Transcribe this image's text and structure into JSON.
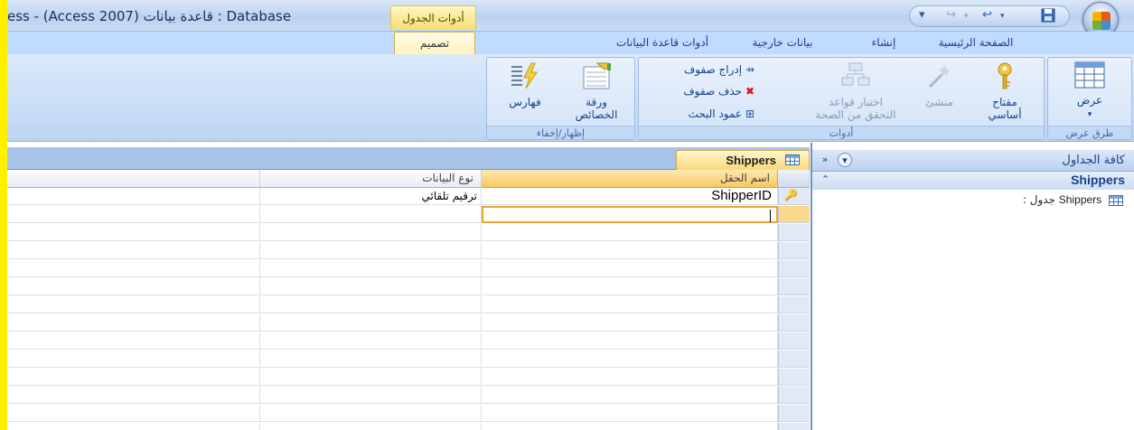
{
  "window": {
    "title": "ess - (Access 2007) قاعدة بيانات : Database",
    "context_tab_title": "أدوات الجدول"
  },
  "ribbon_tabs": [
    {
      "label": "الصفحة الرئيسية"
    },
    {
      "label": "إنشاء"
    },
    {
      "label": "بيانات خارجية"
    },
    {
      "label": "أدوات قاعدة البيانات"
    },
    {
      "label": "تصميم"
    }
  ],
  "ribbon": {
    "views_group": {
      "label": "طرق عرض",
      "view_button": "عرض"
    },
    "tools_group": {
      "label": "أدوات",
      "primary_key_line1": "مفتاح",
      "primary_key_line2": "أساسي",
      "builder": "منشئ",
      "test_rules_line1": "اختبار قواعد",
      "test_rules_line2": "التحقق من الصحة",
      "insert_rows": "إدراج صفوف",
      "delete_rows": "حذف صفوف",
      "lookup_column": "عمود البحث"
    },
    "show_hide_group": {
      "label": "إظهار/إخفاء",
      "property_sheet_line1": "ورقة",
      "property_sheet_line2": "الخصائص",
      "indexes": "فهارس"
    }
  },
  "document": {
    "tab_label": "Shippers",
    "columns": {
      "field_name": "اسم الحقل",
      "data_type": "نوع البيانات"
    },
    "rows": [
      {
        "field_name": "ShipperID",
        "data_type": "ترقيم تلقائي",
        "is_key": true
      }
    ]
  },
  "nav_pane": {
    "title": "كافة الجداول",
    "group_title": "Shippers",
    "items": [
      {
        "name": "Shippers",
        "suffix": " : جدول"
      }
    ]
  },
  "icons": [
    "office-button-icon",
    "save-icon",
    "undo-icon",
    "redo-icon",
    "customize-qat-icon",
    "table-icon",
    "key-icon",
    "builder-icon",
    "test-rules-icon",
    "insert-rows-icon",
    "delete-rows-icon",
    "lookup-icon",
    "property-sheet-icon",
    "indexes-icon",
    "shutter-bar-icon",
    "collapse-group-icon",
    "dropdown-icon"
  ],
  "colors": {
    "accent": "#15428b",
    "context_tab": "#f5dd73",
    "title_highlight": "#ffef00"
  }
}
